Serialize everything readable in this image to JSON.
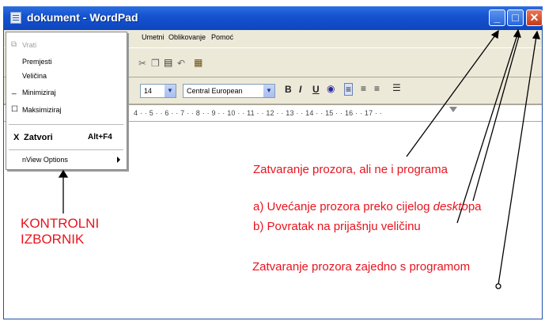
{
  "window": {
    "title": "dokument - WordPad",
    "buttons": {
      "minimize": "_",
      "maximize": "□",
      "close": "✕"
    }
  },
  "menubar": {
    "items": [
      "Umetni",
      "Oblikovanje",
      "Pomoć"
    ]
  },
  "toolbar": {
    "font_size": "14",
    "script": "Central European",
    "bold": "B",
    "italic": "I",
    "underline": "U"
  },
  "ruler": {
    "text": "4 · · 5 · · 6 · · 7 · · 8 · · 9 · · 10 · · 11 · · 12 · · 13 · · 14 · · 15 · · 16 · · 17 · ·"
  },
  "control_menu": {
    "restore": "Vrati",
    "move": "Premjesti",
    "size": "Veličina",
    "minimize": "Minimiziraj",
    "maximize": "Maksimiziraj",
    "close": "Zatvori",
    "close_shortcut": "Alt+F4",
    "extra": "nView Options"
  },
  "annotations": {
    "control_menu_line1": "KONTROLNI",
    "control_menu_line2": "IZBORNIK",
    "minimize_note": "Zatvaranje prozora, ali ne i programa",
    "maximize_note_a": "a) Uvećanje prozora preko cijelog",
    "maximize_note_a_italic": "deskto",
    "maximize_note_a_end": "pa",
    "maximize_note_b": "b) Povratak na prijašnju veličinu",
    "close_note": "Zatvaranje prozora zajedno s programom",
    "color": "#e8141e"
  }
}
